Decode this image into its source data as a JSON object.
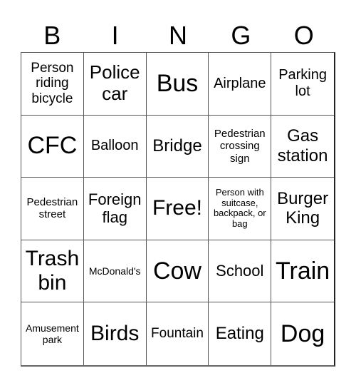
{
  "header": [
    "B",
    "I",
    "N",
    "G",
    "O"
  ],
  "cells": [
    "Person riding bicycle",
    "Police car",
    "Bus",
    "Airplane",
    "Parking lot",
    "CFC",
    "Balloon",
    "Bridge",
    "Pedestrian crossing sign",
    "Gas station",
    "Pedestrian street",
    "Foreign flag",
    "Free!",
    "Person with suitcase, backpack, or bag",
    "Burger King",
    "Trash bin",
    "McDonald's",
    "Cow",
    "School",
    "Train",
    "Amusement park",
    "Birds",
    "Fountain",
    "Eating",
    "Dog"
  ]
}
